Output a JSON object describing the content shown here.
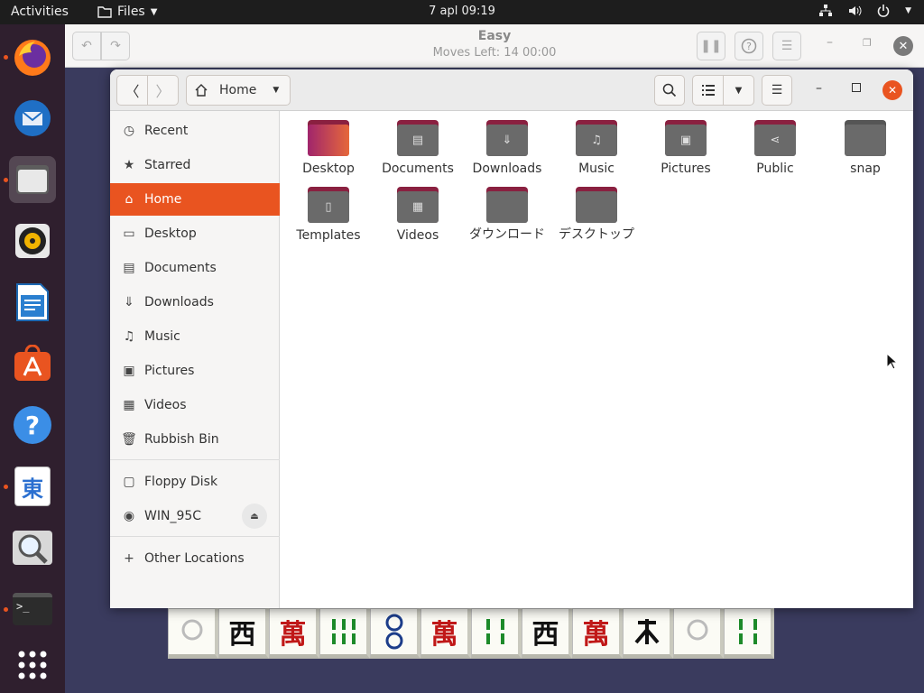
{
  "topbar": {
    "activities": "Activities",
    "app_name": "Files",
    "clock": "7 apl  09:19"
  },
  "mahjongg": {
    "title": "Easy",
    "subtitle": "Moves Left: 14   00:00"
  },
  "files": {
    "location": "Home",
    "sidebar": {
      "recent": "Recent",
      "starred": "Starred",
      "home": "Home",
      "desktop": "Desktop",
      "documents": "Documents",
      "downloads": "Downloads",
      "music": "Music",
      "pictures": "Pictures",
      "videos": "Videos",
      "rubbish": "Rubbish Bin",
      "floppy": "Floppy Disk",
      "win95c": "WIN_95C",
      "other": "Other Locations"
    },
    "folders": [
      {
        "name": "Desktop",
        "icon": "desktop-folder-icon"
      },
      {
        "name": "Documents",
        "icon": "documents-folder-icon"
      },
      {
        "name": "Downloads",
        "icon": "downloads-folder-icon"
      },
      {
        "name": "Music",
        "icon": "music-folder-icon"
      },
      {
        "name": "Pictures",
        "icon": "pictures-folder-icon"
      },
      {
        "name": "Public",
        "icon": "public-folder-icon"
      },
      {
        "name": "snap",
        "icon": "folder-icon"
      },
      {
        "name": "Templates",
        "icon": "templates-folder-icon"
      },
      {
        "name": "Videos",
        "icon": "videos-folder-icon"
      },
      {
        "name": "ダウンロード",
        "icon": "folder-icon"
      },
      {
        "name": "デスクトップ",
        "icon": "folder-icon"
      }
    ]
  },
  "dock": {
    "launcher": "東",
    "terminal": ">_"
  },
  "tiles": [
    "",
    "西",
    "萬",
    "",
    "",
    "萬",
    "",
    "西",
    "萬",
    "",
    "",
    ""
  ],
  "colors": {
    "accent": "#e95420",
    "folder": "#6a6a6a"
  }
}
